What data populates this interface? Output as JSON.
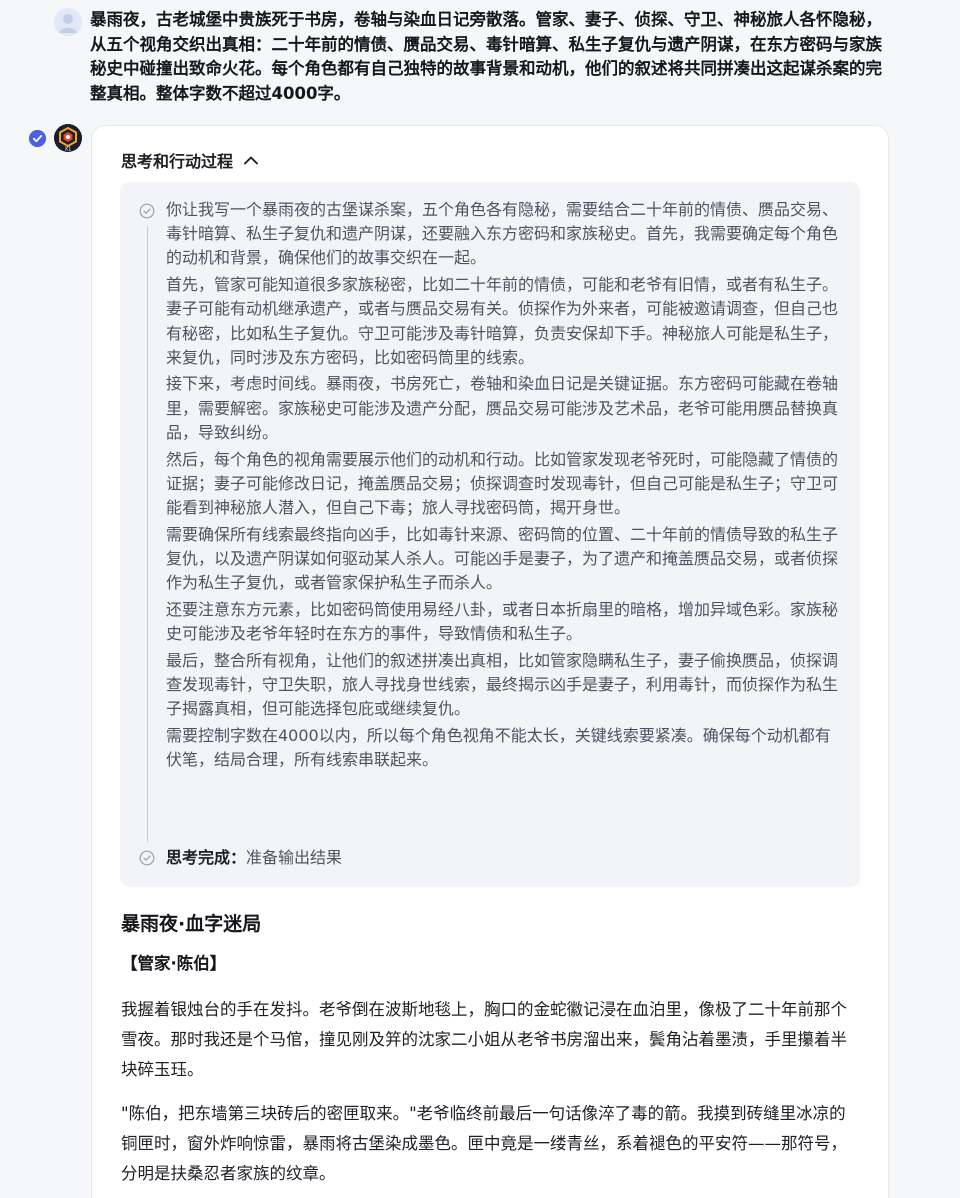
{
  "user_message": {
    "text": "暴雨夜，古老城堡中贵族死于书房，卷轴与染血日记旁散落。管家、妻子、侦探、守卫、神秘旅人各怀隐秘，从五个视角交织出真相：二十年前的情债、赝品交易、毒针暗算、私生子复仇与遗产阴谋，在东方密码与家族秘史中碰撞出致命火花。每个角色都有自己独特的故事背景和动机，他们的叙述将共同拼凑出这起谋杀案的完整真相。整体字数不超过4000字。"
  },
  "assistant": {
    "avatar_label": "X1",
    "thinking": {
      "title": "思考和行动过程",
      "steps": [
        "你让我写一个暴雨夜的古堡谋杀案，五个角色各有隐秘，需要结合二十年前的情债、赝品交易、毒针暗算、私生子复仇和遗产阴谋，还要融入东方密码和家族秘史。首先，我需要确定每个角色的动机和背景，确保他们的故事交织在一起。",
        "首先，管家可能知道很多家族秘密，比如二十年前的情债，可能和老爷有旧情，或者有私生子。妻子可能有动机继承遗产，或者与赝品交易有关。侦探作为外来者，可能被邀请调查，但自己也有秘密，比如私生子复仇。守卫可能涉及毒针暗算，负责安保却下手。神秘旅人可能是私生子，来复仇，同时涉及东方密码，比如密码筒里的线索。",
        "接下来，考虑时间线。暴雨夜，书房死亡，卷轴和染血日记是关键证据。东方密码可能藏在卷轴里，需要解密。家族秘史可能涉及遗产分配，赝品交易可能涉及艺术品，老爷可能用赝品替换真品，导致纠纷。",
        "然后，每个角色的视角需要展示他们的动机和行动。比如管家发现老爷死时，可能隐藏了情债的证据；妻子可能修改日记，掩盖赝品交易；侦探调查时发现毒针，但自己可能是私生子；守卫可能看到神秘旅人潜入，但自己下毒；旅人寻找密码筒，揭开身世。",
        "需要确保所有线索最终指向凶手，比如毒针来源、密码筒的位置、二十年前的情债导致的私生子复仇，以及遗产阴谋如何驱动某人杀人。可能凶手是妻子，为了遗产和掩盖赝品交易，或者侦探作为私生子复仇，或者管家保护私生子而杀人。",
        "还要注意东方元素，比如密码筒使用易经八卦，或者日本折扇里的暗格，增加异域色彩。家族秘史可能涉及老爷年轻时在东方的事件，导致情债和私生子。",
        "最后，整合所有视角，让他们的叙述拼凑出真相，比如管家隐瞒私生子，妻子偷换赝品，侦探调查发现毒针，守卫失职，旅人寻找身世线索，最终揭示凶手是妻子，利用毒针，而侦探作为私生子揭露真相，但可能选择包庇或继续复仇。",
        "需要控制字数在4000以内，所以每个角色视角不能太长，关键线索要紧凑。确保每个动机都有伏笔，结局合理，所有线索串联起来。"
      ],
      "done_label": "思考完成：",
      "done_text": "准备输出结果"
    },
    "answer": {
      "title": "暴雨夜·血字迷局",
      "section": "【管家·陈伯】",
      "paragraphs": [
        "我握着银烛台的手在发抖。老爷倒在波斯地毯上，胸口的金蛇徽记浸在血泊里，像极了二十年前那个雪夜。那时我还是个马倌，撞见刚及笄的沈家二小姐从老爷书房溜出来，鬓角沾着墨渍，手里攥着半块碎玉珏。",
        "\"陈伯，把东墙第三块砖后的密匣取来。\"老爷临终前最后一句话像淬了毒的箭。我摸到砖缝里冰凉的铜匣时，窗外炸响惊雷，暴雨将古堡染成墨色。匣中竟是一缕青丝，系着褪色的平安符——那符号，分明是扶桑忍者家族的纹章。"
      ]
    }
  },
  "colors": {
    "accent": "#4b61e0",
    "card_bg": "#ffffff",
    "page_bg": "#f6f7f9",
    "thinking_bg": "#f3f4f7"
  },
  "icons": {
    "user_avatar": "user-avatar-icon",
    "bot_avatar": "x1-logo-icon",
    "status": "check-circle-icon",
    "collapse": "chevron-up-icon",
    "thinking_step": "check-circle-outline-icon"
  }
}
